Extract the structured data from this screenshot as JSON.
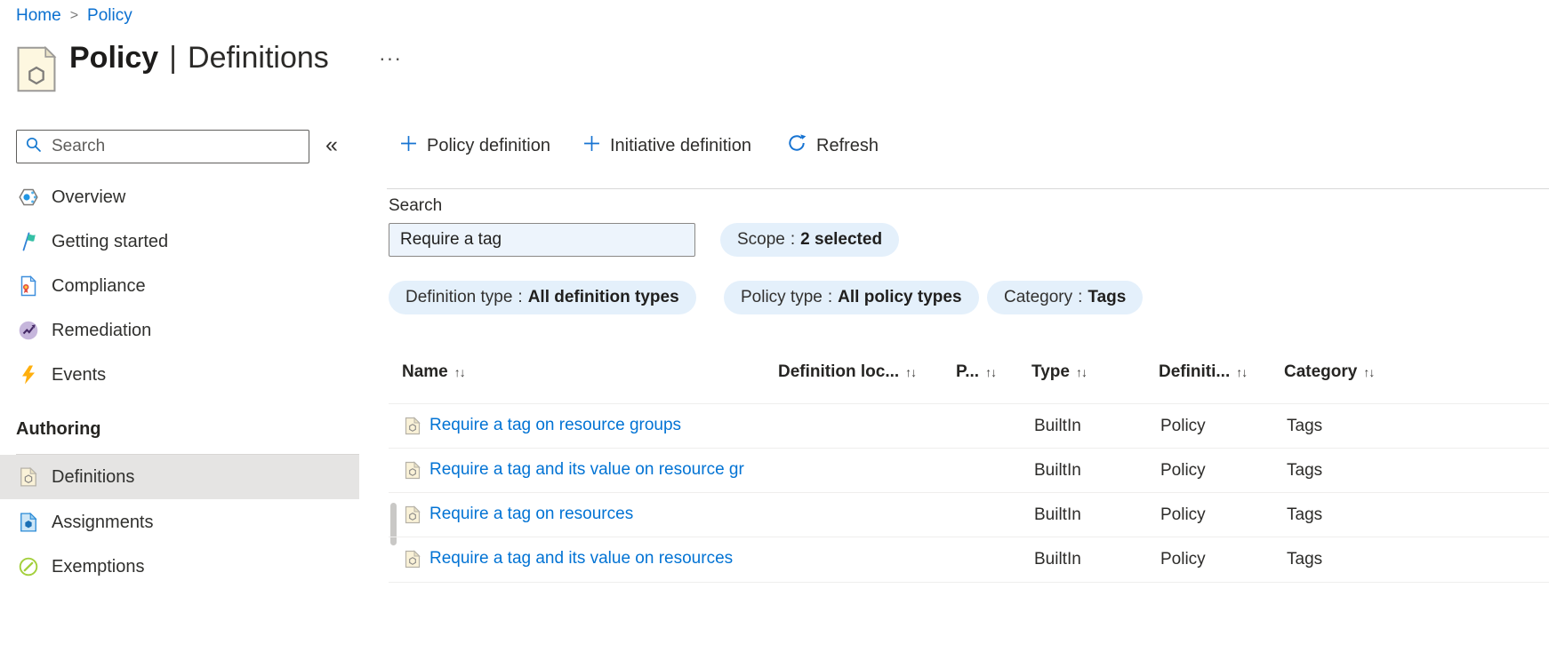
{
  "breadcrumb": {
    "separator": ">",
    "items": [
      {
        "label": "Home"
      },
      {
        "label": "Policy"
      }
    ]
  },
  "header": {
    "title_primary": "Policy",
    "title_divider": "|",
    "title_secondary": "Definitions",
    "more_glyph": "···"
  },
  "sidebar": {
    "search": {
      "placeholder": "Search"
    },
    "collapse_glyph": "«",
    "items": [
      {
        "label": "Overview"
      },
      {
        "label": "Getting started"
      },
      {
        "label": "Compliance"
      },
      {
        "label": "Remediation"
      },
      {
        "label": "Events"
      }
    ],
    "authoring": {
      "label": "Authoring",
      "items": [
        {
          "label": "Definitions",
          "selected": true
        },
        {
          "label": "Assignments",
          "selected": false
        },
        {
          "label": "Exemptions",
          "selected": false
        }
      ]
    }
  },
  "toolbar": {
    "buttons": [
      {
        "label": "Policy definition"
      },
      {
        "label": "Initiative definition"
      },
      {
        "label": "Refresh"
      }
    ]
  },
  "filters": {
    "search_label": "Search",
    "search_value": "Require a tag",
    "pill_separator": ":",
    "pills": [
      {
        "name": "Scope",
        "value": "2 selected"
      },
      {
        "name": "Definition type",
        "value": "All definition types"
      },
      {
        "name": "Policy type",
        "value": "All policy types"
      },
      {
        "name": "Category",
        "value": "Tags"
      }
    ]
  },
  "table": {
    "sort_glyph": "↑↓",
    "columns": [
      {
        "label": "Name"
      },
      {
        "label": "Definition loc..."
      },
      {
        "label": "P..."
      },
      {
        "label": "Type"
      },
      {
        "label": "Definiti..."
      },
      {
        "label": "Category"
      }
    ],
    "rows": [
      {
        "name": "Require a tag on resource groups",
        "definition_location": "",
        "p": "",
        "type": "BuiltIn",
        "definition_type": "Policy",
        "category": "Tags"
      },
      {
        "name": "Require a tag and its value on resource gr",
        "definition_location": "",
        "p": "",
        "type": "BuiltIn",
        "definition_type": "Policy",
        "category": "Tags"
      },
      {
        "name": "Require a tag on resources",
        "definition_location": "",
        "p": "",
        "type": "BuiltIn",
        "definition_type": "Policy",
        "category": "Tags"
      },
      {
        "name": "Require a tag and its value on resources",
        "definition_location": "",
        "p": "",
        "type": "BuiltIn",
        "definition_type": "Policy",
        "category": "Tags"
      }
    ]
  },
  "colors": {
    "accent_blue": "#0078d4",
    "link_blue": "#0273d4",
    "pill_bg": "#e4f0fb",
    "input_bg": "#edf4fc",
    "selected_item_bg": "#e5e4e3",
    "text": "#323130"
  }
}
